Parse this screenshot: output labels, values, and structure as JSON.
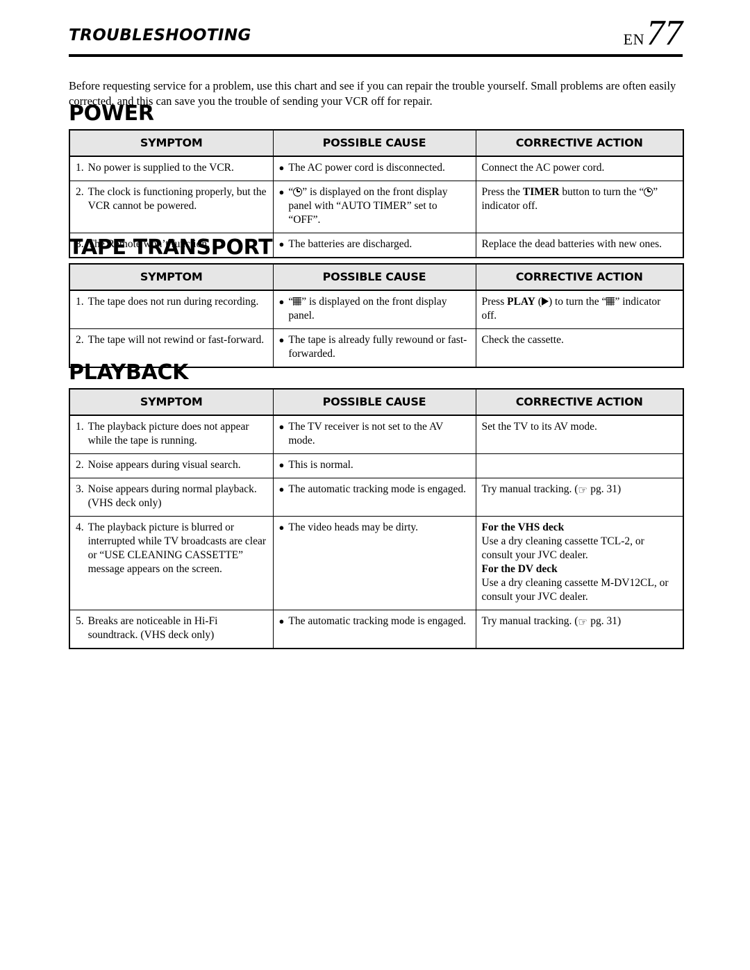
{
  "header": {
    "chapter_title": "TROUBLESHOOTING",
    "folio_lang": "EN",
    "folio_number": "77"
  },
  "intro": {
    "text": "Before requesting service for a problem, use this chart and see if you can repair the trouble yourself. Small problems are often easily corrected, and this can save you the trouble of sending your VCR off for repair."
  },
  "columns": {
    "symptom": "SYMPTOM",
    "possible_cause": "POSSIBLE CAUSE",
    "corrective_action": "CORRECTIVE ACTION"
  },
  "icons": {
    "timer": "timer-clock-icon",
    "tape": "tape-indicator-icon",
    "play": "play-triangle-icon",
    "hand": "pointing-hand-icon",
    "hand_glyph": "☞",
    "bullet": "●"
  },
  "colors": {
    "header_fill": "#e6e6e6",
    "text": "#000000",
    "rule": "#000000"
  },
  "sections": [
    {
      "title": "POWER",
      "rows": [
        {
          "num": "1.",
          "symptom": "No power is supplied to the VCR.",
          "cause": "The AC power cord is disconnected.",
          "action_1": "Connect the AC power cord.",
          "action_2": "",
          "action_3": ""
        },
        {
          "num": "2.",
          "symptom": "The clock is functioning properly, but the VCR cannot be powered.",
          "cause_pre": "“",
          "cause_post": "” is displayed on the front display panel with “AUTO TIMER” set to “OFF”.",
          "action_pre": "Press the ",
          "action_bold": "TIMER",
          "action_mid": " button to turn the “",
          "action_post": "” indicator off."
        },
        {
          "num": "3.",
          "symptom": "The Remote won’t function.",
          "cause": "The batteries are discharged.",
          "action_1": "Replace the dead batteries with new ones.",
          "action_2": "",
          "action_3": ""
        }
      ]
    },
    {
      "title": "TAPE TRANSPORT",
      "rows": [
        {
          "num": "1.",
          "symptom": "The tape does not run during recording.",
          "cause_pre": "“",
          "cause_post": "” is displayed on the front display panel.",
          "action_pre": "Press ",
          "action_bold": "PLAY",
          "action_mid": " (",
          "action_mid2": ") to turn the “",
          "action_post": "” indicator off."
        },
        {
          "num": "2.",
          "symptom": "The tape will not rewind or fast-forward.",
          "cause": "The tape is already fully rewound or fast-forwarded.",
          "action_1": "Check the cassette.",
          "action_2": "",
          "action_3": ""
        }
      ]
    },
    {
      "title": "PLAYBACK",
      "rows": [
        {
          "num": "1.",
          "symptom": "The playback picture does not appear while the tape is running.",
          "cause": "The TV receiver is not set to the AV mode.",
          "action_1": "Set the TV to its AV mode.",
          "action_2": "",
          "action_3": ""
        },
        {
          "num": "2.",
          "symptom": "Noise appears during visual search.",
          "cause": "This is normal.",
          "action_1": "",
          "action_2": "",
          "action_3": ""
        },
        {
          "num": "3.",
          "symptom": "Noise appears during normal playback. (VHS deck only)",
          "cause": "The automatic tracking mode is engaged.",
          "action_pre": "Try manual tracking. (",
          "action_post": " pg. 31)"
        },
        {
          "num": "4.",
          "symptom": "The playback picture is blurred or interrupted while TV broadcasts are clear or “USE CLEANING CASSETTE” message appears on the screen.",
          "cause": "The video heads may be dirty.",
          "action_head_1": "For the VHS deck",
          "action_body_1": "Use a dry cleaning cassette TCL-2, or consult your JVC dealer.",
          "action_head_2": "For the DV deck",
          "action_body_2": "Use a dry cleaning cassette M-DV12CL, or consult your JVC dealer."
        },
        {
          "num": "5.",
          "symptom": "Breaks are noticeable in Hi-Fi soundtrack. (VHS deck only)",
          "cause": "The automatic tracking mode is engaged.",
          "action_pre": "Try manual tracking. (",
          "action_post": " pg. 31)"
        }
      ]
    }
  ]
}
